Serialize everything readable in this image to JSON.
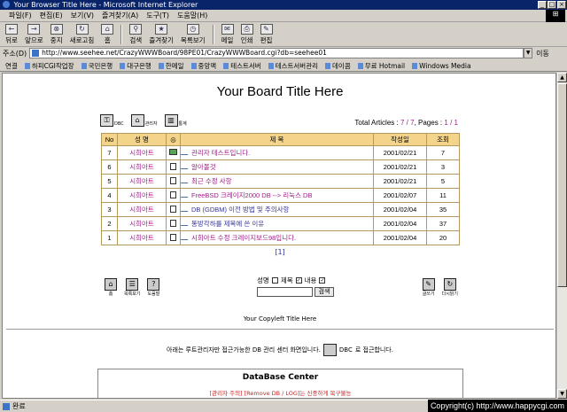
{
  "window": {
    "title": "Your Browser Title Here - Microsoft Internet Explorer"
  },
  "menu": [
    "파일(F)",
    "편집(E)",
    "보기(V)",
    "즐겨찾기(A)",
    "도구(T)",
    "도움말(H)"
  ],
  "toolbar": [
    {
      "label": "뒤로",
      "icon": "back-icon"
    },
    {
      "label": "앞으로",
      "icon": "forward-icon"
    },
    {
      "label": "중지",
      "icon": "stop-icon"
    },
    {
      "label": "새로고침",
      "icon": "refresh-icon"
    },
    {
      "label": "홈",
      "icon": "home-icon"
    },
    {
      "label": "검색",
      "icon": "search-icon"
    },
    {
      "label": "즐겨찾기",
      "icon": "favorites-icon"
    },
    {
      "label": "목록보기",
      "icon": "history-icon"
    },
    {
      "label": "메일",
      "icon": "mail-icon"
    },
    {
      "label": "인쇄",
      "icon": "print-icon"
    },
    {
      "label": "편집",
      "icon": "edit-icon"
    }
  ],
  "address": {
    "label": "주소(D)",
    "url": "http://www.seehee.net/CrazyWWWBoard/98PE01/CrazyWWWBoard.cgi?db=seehee01",
    "go": "이동"
  },
  "links": {
    "label": "연결",
    "items": [
      "하피CGI작업장",
      "국민은행",
      "대구은행",
      "한메일",
      "중앙맥",
      "테스트서버",
      "테스트서버관리",
      "데이콤",
      "무료 Hotmail",
      "Windows Media"
    ]
  },
  "board": {
    "title": "Your Board Title Here",
    "icons": [
      "DBC",
      "관리자",
      "통계"
    ],
    "articles_label": "Total Articles :",
    "articles": "7",
    "articles_total": "7",
    "pages_label": ", Pages :",
    "pages": "1",
    "pages_total": "1",
    "headers": [
      "No",
      "성 명",
      "◎",
      "제 목",
      "작성일",
      "조회"
    ],
    "rows": [
      {
        "no": "7",
        "name": "시희아트",
        "subject": "관리자 테스트입니다.",
        "date": "2001/02/21",
        "views": "7",
        "memo": "green"
      },
      {
        "no": "6",
        "name": "시희아트",
        "subject": "알아볼것",
        "date": "2001/02/21",
        "views": "3",
        "memo": "doc"
      },
      {
        "no": "5",
        "name": "시희아트",
        "subject": "최근 수정 사항",
        "date": "2001/02/21",
        "views": "5",
        "memo": "doc"
      },
      {
        "no": "4",
        "name": "시희아트",
        "subject": "FreeBSD 크레이지2000 DB --> 리눅스 DB",
        "date": "2001/02/07",
        "views": "11",
        "memo": "doc"
      },
      {
        "no": "3",
        "name": "시희아트",
        "subject": "DB (GDBM) 이전 방법 및 주의사항",
        "date": "2001/02/04",
        "views": "35",
        "memo": "doc"
      },
      {
        "no": "2",
        "name": "시희아트",
        "subject": "똥방각하를 제목에 쓴 이유",
        "date": "2001/02/04",
        "views": "37",
        "memo": "doc"
      },
      {
        "no": "1",
        "name": "시희아트",
        "subject": "시희아트 수정 크레이지보드98입니다.",
        "date": "2001/02/04",
        "views": "20",
        "memo": "doc"
      }
    ],
    "pager": "[1]",
    "bottom_left": [
      "홈",
      "목록보기",
      "도움말"
    ],
    "bottom_right": [
      "글쓰기",
      "다시읽기"
    ],
    "search": {
      "name_label": "성명",
      "subject_label": "제목",
      "content_label": "내용",
      "button": "검색"
    },
    "copyleft": "Your Copyleft Title Here",
    "dbc_note_pre": "아래는 루트관리자만 접근가능한 DB 관리 센터 화면입니다.",
    "dbc_note_post": "로 접근합니다.",
    "dbc_label": "DBC",
    "db_center_title": "DataBase Center",
    "db_center_warning": "[관리자 주의] [Remove DB / LOG]는 신중하게 복구불능"
  },
  "status": {
    "text": "완료"
  },
  "overlay": {
    "copyright": "Copyright(c) http://www.happycgi.com"
  }
}
